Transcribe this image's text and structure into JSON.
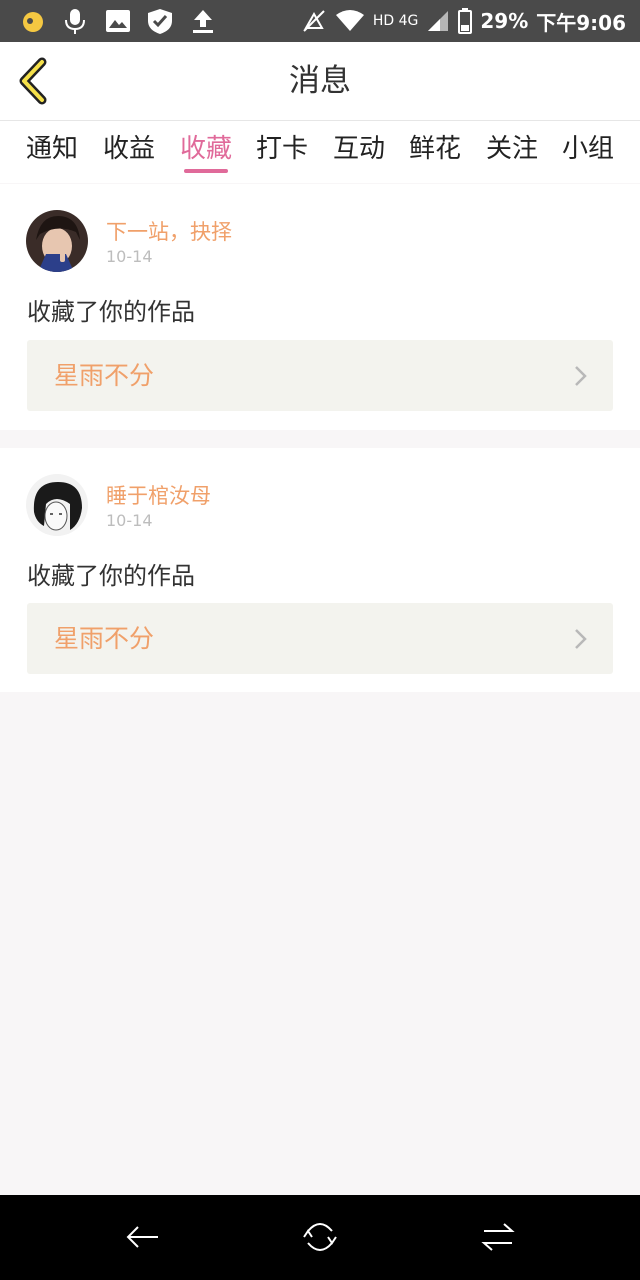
{
  "status_bar": {
    "icons": [
      "app-notification-icon",
      "mic-icon",
      "image-icon",
      "shield-check-icon",
      "upload-icon",
      "mute-icon",
      "wifi-icon",
      "signal-icon",
      "battery-icon"
    ],
    "network": "HD 4G",
    "battery": "29%",
    "time": "下午9:06"
  },
  "header": {
    "title": "消息"
  },
  "tabs": [
    {
      "label": "通知"
    },
    {
      "label": "收益"
    },
    {
      "label": "收藏"
    },
    {
      "label": "打卡"
    },
    {
      "label": "互动"
    },
    {
      "label": "鲜花"
    },
    {
      "label": "关注"
    },
    {
      "label": "小组"
    }
  ],
  "active_tab": "收藏",
  "colors": {
    "accent": "#e06a9a",
    "name": "#f0a06a",
    "work_bg": "#f3f3ee"
  },
  "messages": [
    {
      "user": "下一站，抉择",
      "date": "10-14",
      "action": "收藏了你的作品",
      "work_title": "星雨不分"
    },
    {
      "user": "睡于棺汝母",
      "date": "10-14",
      "action": "收藏了你的作品",
      "work_title": "星雨不分"
    }
  ]
}
